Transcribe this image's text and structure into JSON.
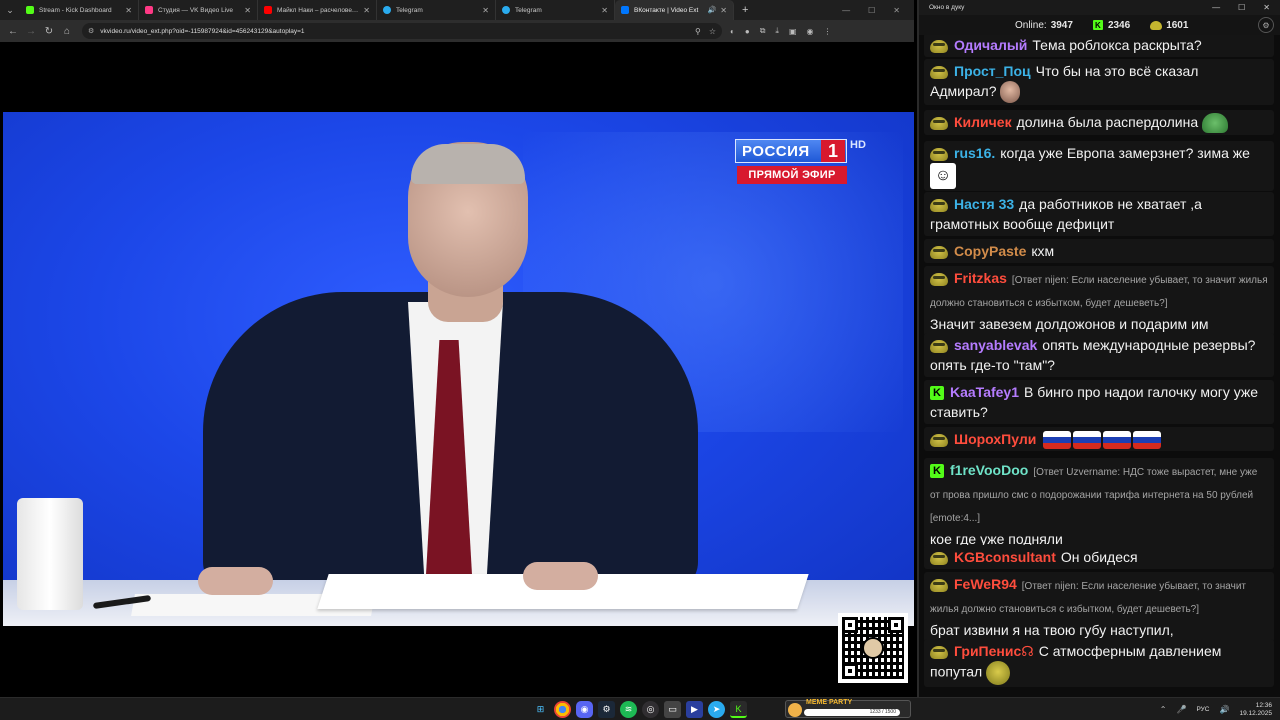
{
  "browser": {
    "tabs": [
      {
        "title": "Stream - Kick Dashboard",
        "favicon_color": "#53fc18",
        "active": false
      },
      {
        "title": "Студия — VK Видео Live",
        "favicon_color": "#ff3985",
        "active": false
      },
      {
        "title": "Майкл Наки – расчеловечив...",
        "favicon_color": "#ff0000",
        "active": false
      },
      {
        "title": "Telegram",
        "favicon_color": "#2aabee",
        "active": false
      },
      {
        "title": "Telegram",
        "favicon_color": "#2aabee",
        "active": false
      },
      {
        "title": "ВКонтакте | Video Ext",
        "favicon_color": "#0077ff",
        "active": true
      }
    ],
    "url": "vkvideo.ru/video_ext.php?oid=-115987924&id=456243129&autoplay=1"
  },
  "video": {
    "channel_logo": "РОССИЯ",
    "channel_number": "1",
    "hd_label": "HD",
    "live_label": "ПРЯМОЙ ЭФИР"
  },
  "chat_window": {
    "title": "Окно в дуку",
    "online_label": "Online:",
    "online_value": "3947",
    "kick_count": "2346",
    "pepe_count": "1601",
    "messages": [
      {
        "badge": "pepe",
        "user": "Одичалый",
        "color": "#b57cff",
        "reply": "",
        "text": "Тема роблокса раскрыта?",
        "emote": ""
      },
      {
        "badge": "pepe",
        "user": "Прост_Поц",
        "color": "#3cb2e6",
        "reply": "",
        "text": "Что бы на это всё сказал Адмирал?",
        "emote": "face"
      },
      {
        "badge": "pepe",
        "user": "Киличек",
        "color": "#ff4d3d",
        "reply": "",
        "text": "долина была распердолина",
        "emote": "frog"
      },
      {
        "badge": "pepe",
        "user": "rus16.",
        "color": "#3cb2e6",
        "reply": "",
        "text": "когда уже Европа замерзнет? зима же",
        "emote": "smile"
      },
      {
        "badge": "pepe",
        "user": "Настя 33",
        "color": "#3cb2e6",
        "reply": "",
        "text": "да работников не хватает ,а грамотных вообще дефицит",
        "emote": ""
      },
      {
        "badge": "pepe",
        "user": "CopyPaste",
        "color": "#d28c4a",
        "reply": "",
        "text": "кхм",
        "emote": ""
      },
      {
        "badge": "pepe",
        "user": "Fritzkas",
        "color": "#ff4d3d",
        "reply": "[Ответ nijen: Если население убывает, то значит жилья должно становиться с избытком, будет дешеветь?]",
        "text": "Значит завезем долдожонов и подарим им",
        "emote": ""
      },
      {
        "badge": "pepe",
        "user": "sanyablevak",
        "color": "#b57cff",
        "reply": "",
        "text": "опять международные резервы? опять где-то \"там\"?",
        "emote": ""
      },
      {
        "badge": "kick",
        "user": "KaaTafey1",
        "color": "#b57cff",
        "reply": "",
        "text": "В бинго про надои галочку могу уже ставить?",
        "emote": ""
      },
      {
        "badge": "pepe",
        "user": "ШорохПули",
        "color": "#ff4d3d",
        "reply": "",
        "text": "",
        "emote": "flags"
      },
      {
        "badge": "kick",
        "user": "f1reVooDoo",
        "color": "#6fe3c8",
        "reply": "[Ответ Uzvername: НДС тоже вырастет, мне уже от прова пришло смс о подорожании тарифа интернета на 50 рублей [emote:4...]",
        "text": "кое где уже подняли",
        "emote": ""
      },
      {
        "badge": "pepe",
        "user": "KGBconsultant",
        "color": "#ff4d3d",
        "reply": "",
        "text": "Он обидеся",
        "emote": ""
      },
      {
        "badge": "pepe",
        "user": "FeWeR94",
        "color": "#ff4d3d",
        "reply": "[Ответ nijen: Если население убывает, то значит жилья должно становиться с избытком, будет дешеветь?]",
        "text": "брат извини я на твою губу наступил,",
        "emote": ""
      },
      {
        "badge": "pepe",
        "user": "ГриПенис☊",
        "color": "#ff4d3d",
        "reply": "",
        "text": "С атмосферным давлением попутал",
        "emote": "pepe2"
      }
    ]
  },
  "taskbar": {
    "widget_title": "MEME PARTY",
    "widget_value": "1233 / 1500",
    "language": "РУС",
    "time": "12:36",
    "date": "19.12.2025"
  }
}
